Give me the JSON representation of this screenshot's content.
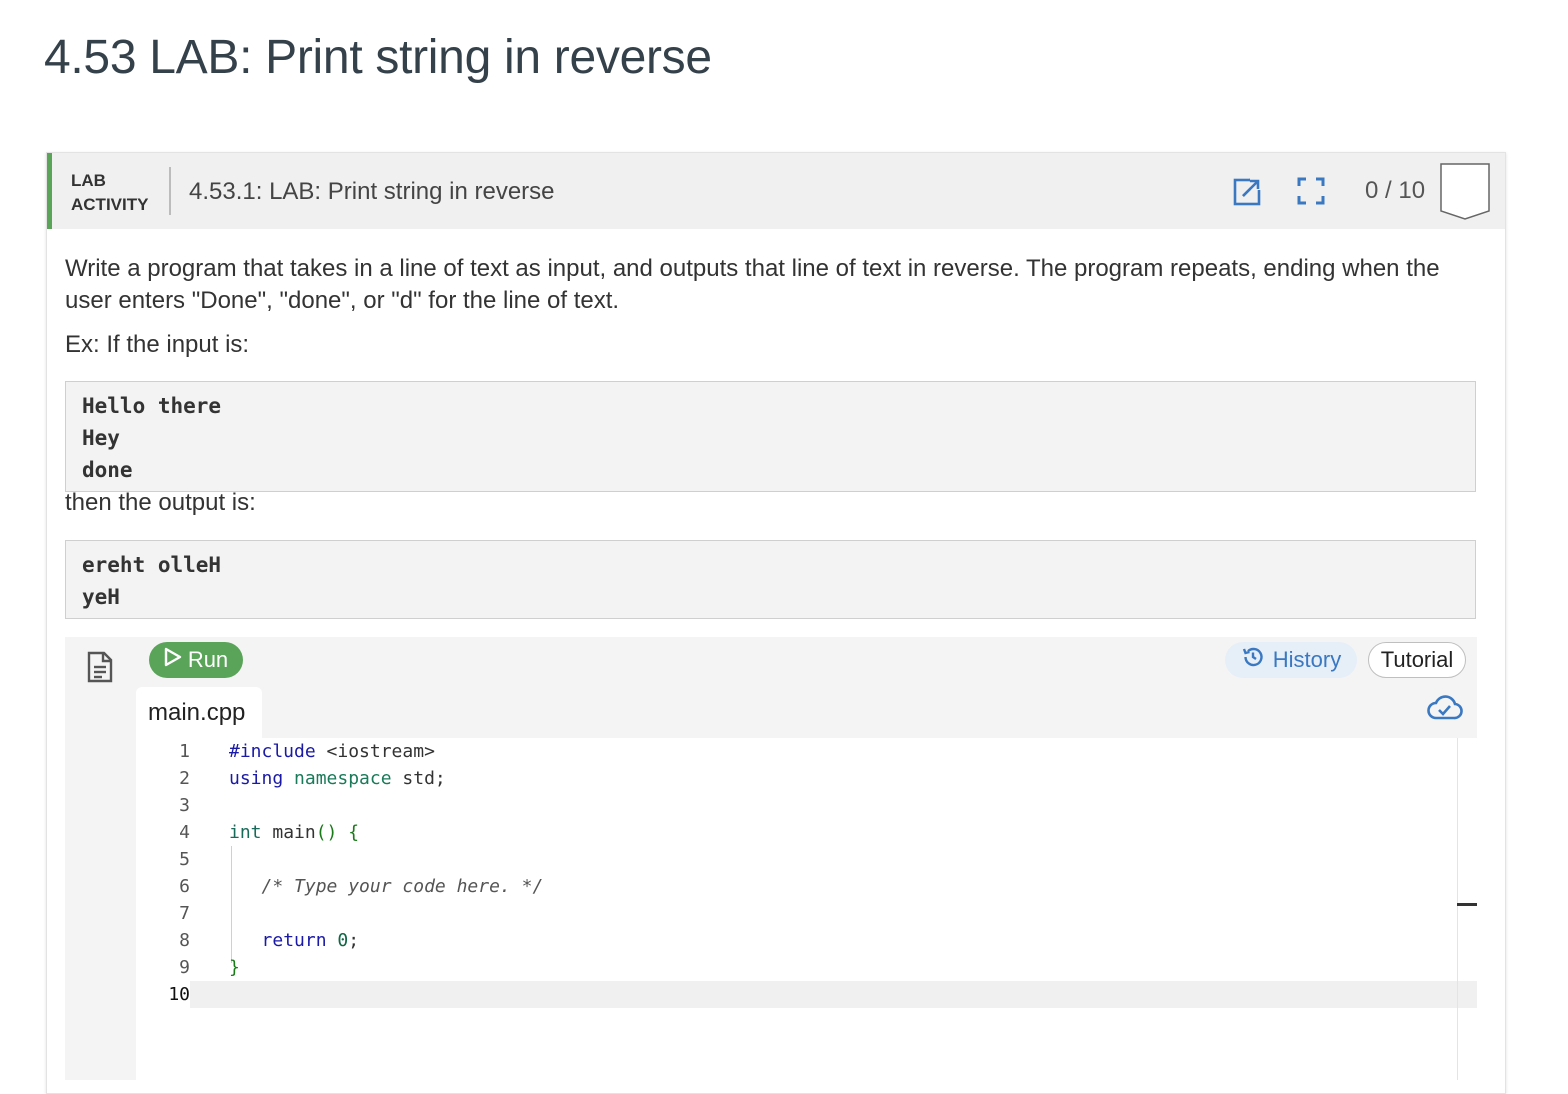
{
  "page_title": "4.53 LAB: Print string in reverse",
  "activity": {
    "label_line1": "LAB",
    "label_line2": "ACTIVITY",
    "title": "4.53.1: LAB: Print string in reverse",
    "score": "0 / 10",
    "icons": {
      "open": "external-link-icon",
      "expand": "fullscreen-icon",
      "badge": "score-badge-icon"
    }
  },
  "content": {
    "prompt": "Write a program that takes in a line of text as input, and outputs that line of text in reverse. The program repeats, ending when the user enters \"Done\", \"done\", or \"d\" for the line of text.",
    "example_label": "Ex: If the input is:",
    "input_lines": [
      "Hello there",
      "Hey",
      "done"
    ],
    "output_label": "then the output is:",
    "output_lines": [
      "ereht olleH",
      "yeH"
    ]
  },
  "ide": {
    "run_label": "Run",
    "history_label": "History",
    "tutorial_label": "Tutorial",
    "file_tab": "main.cpp",
    "line_numbers": [
      "1",
      "2",
      "3",
      "4",
      "5",
      "6",
      "7",
      "8",
      "9",
      "10"
    ],
    "code": {
      "l1_kw": "#include",
      "l1_rest": " <iostream>",
      "l2_kw1": "using",
      "l2_kw2": " namespace",
      "l2_rest": " std;",
      "l4_kw": "int",
      "l4_rest": " main",
      "l4_paren": "()",
      "l4_brace": " {",
      "l6_comment": "/* Type your code here. */",
      "l8_kw": "return",
      "l8_num": " 0",
      "l8_semi": ";",
      "l9_brace": "}"
    },
    "colors": {
      "run": "#5aa45a",
      "accent_bar": "#5aa45a",
      "history_text": "#3a78c2"
    }
  }
}
